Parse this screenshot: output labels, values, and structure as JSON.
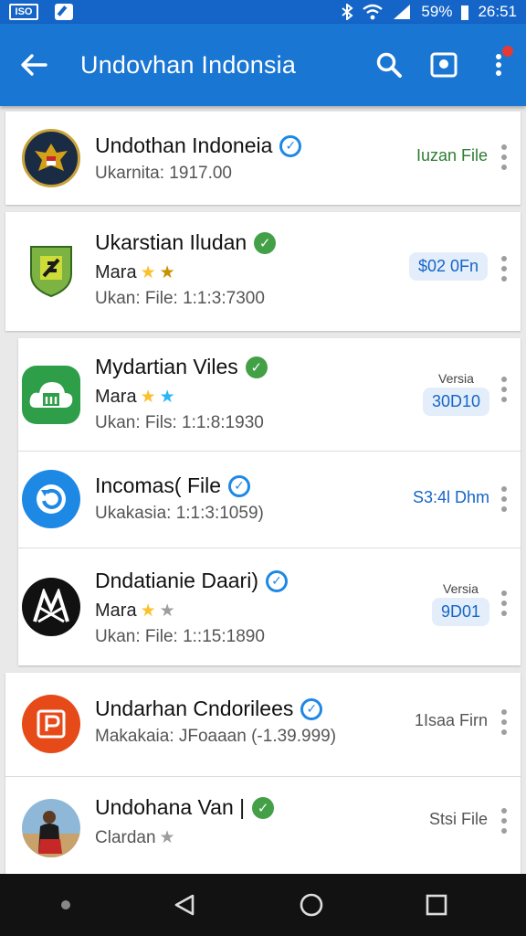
{
  "status_bar": {
    "left_badge": "ISO",
    "battery": "59%",
    "time": "26:51"
  },
  "app_bar": {
    "title": "Undovhan Indonsia",
    "back_icon": "arrow-left-icon",
    "search_icon": "search-icon",
    "image_icon": "image-icon",
    "menu_icon": "more-vert-icon",
    "accent": "#1976d2"
  },
  "items": [
    {
      "name": "Undothan Indoneia",
      "verified": "blue",
      "sub": "Ukarnita: 1917.00",
      "action": "Iuzan File",
      "action_color": "#2e7d32"
    },
    {
      "name": "Ukarstian Iludan",
      "verified": "green",
      "rating_label": "Mara",
      "sub": "Ukan: File: 1:1:3:7300",
      "action": "$02 0Fn",
      "action_color": "#1565c8"
    },
    {
      "name": "Mydartian Viles",
      "verified": "green",
      "rating_label": "Mara",
      "sub": "Ukan: Fils: 1:1:8:1930",
      "action_label": "Versia",
      "action": "30D10",
      "action_color": "#1565c8"
    },
    {
      "name": "Incomas( File",
      "verified": "blue",
      "sub": "Ukakasia: 1:1:3:1059)",
      "action": "S3:4l Dhm",
      "action_color": "#1565c8"
    },
    {
      "name": "Dndatianie Daari)",
      "verified": "blue",
      "rating_label": "Mara",
      "sub": "Ukan: File: 1::15:1890",
      "action_label": "Versia",
      "action": "9D01",
      "action_color": "#1565c8"
    },
    {
      "name": "Undarhan Cndorilees",
      "verified": "blue",
      "sub": "Makakaia: JFoaaan (-1.39.999)",
      "action": "1Isaa Firn",
      "action_color": "#555555"
    },
    {
      "name": "Undohana Van |",
      "verified": "green",
      "sub": "Clardan",
      "action": "Stsi File",
      "action_color": "#555555"
    }
  ],
  "nav_bar": {
    "back_icon": "triangle-back-icon",
    "home_icon": "circle-home-icon",
    "recents_icon": "square-recents-icon"
  }
}
